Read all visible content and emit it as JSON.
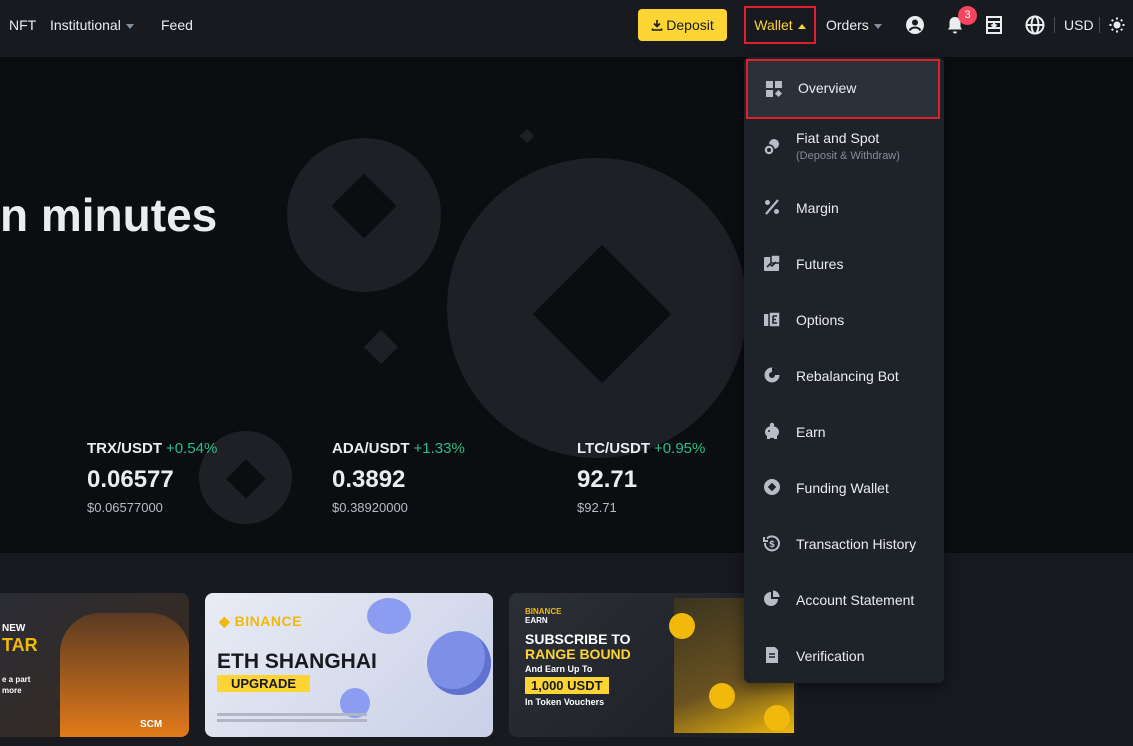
{
  "nav": {
    "nft": "NFT",
    "institutional": "Institutional",
    "feed": "Feed",
    "deposit": "Deposit",
    "wallet": "Wallet",
    "orders": "Orders",
    "notifications_count": "3",
    "currency": "USD"
  },
  "hero": {
    "title": "n minutes",
    "tickers": [
      {
        "pair": "TRX/USDT",
        "change": "+0.54%",
        "price": "0.06577",
        "usd": "$0.06577000"
      },
      {
        "pair": "ADA/USDT",
        "change": "+1.33%",
        "price": "0.3892",
        "usd": "$0.38920000"
      },
      {
        "pair": "LTC/USDT",
        "change": "+0.95%",
        "price": "92.71",
        "usd": "$92.71"
      }
    ]
  },
  "wallet_menu": {
    "items": [
      {
        "label": "Overview",
        "icon": "grid-icon"
      },
      {
        "label": "Fiat and Spot",
        "sub": "(Deposit & Withdraw)",
        "icon": "fiat-spot-icon"
      },
      {
        "label": "Margin",
        "icon": "percent-icon"
      },
      {
        "label": "Futures",
        "icon": "futures-icon"
      },
      {
        "label": "Options",
        "icon": "options-icon"
      },
      {
        "label": "Rebalancing Bot",
        "icon": "bot-icon"
      },
      {
        "label": "Earn",
        "icon": "piggy-icon"
      },
      {
        "label": "Funding Wallet",
        "icon": "funding-icon"
      },
      {
        "label": "Transaction History",
        "icon": "history-icon"
      },
      {
        "label": "Account Statement",
        "icon": "pie-icon"
      },
      {
        "label": "Verification",
        "icon": "document-icon"
      }
    ]
  },
  "banners": {
    "b1": {
      "l1": "NEW",
      "l2": "TAR",
      "l3": "e a part",
      "l4": "more",
      "sponsor": "SCM"
    },
    "b2": {
      "brand": "BINANCE",
      "headline": "ETH SHANGHAI",
      "tag": "UPGRADE"
    },
    "b3": {
      "brand1": "BINANCE",
      "brand2": "EARN",
      "l1": "SUBSCRIBE TO",
      "l2": "RANGE BOUND",
      "l3": "And Earn Up To",
      "l4": "1,000 USDT",
      "l5": "In Token Vouchers"
    }
  },
  "colors": {
    "accent": "#fcd535",
    "positive": "#2ebd85",
    "highlight": "#e0202f"
  }
}
